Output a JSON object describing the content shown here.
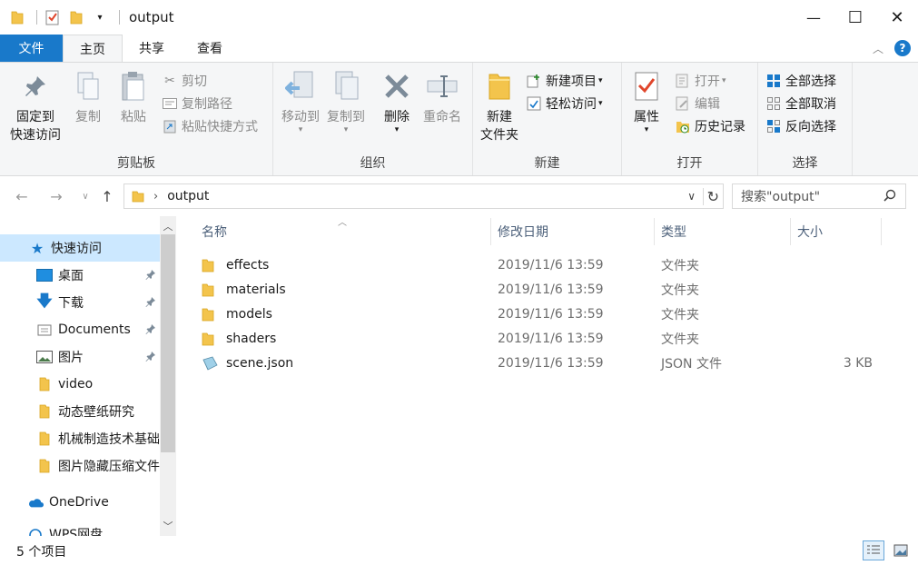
{
  "window": {
    "title": "output",
    "minimize_glyph": "—",
    "maximize_glyph": "☐",
    "close_glyph": "✕"
  },
  "tabs": {
    "file": "文件",
    "home": "主页",
    "share": "共享",
    "view": "查看"
  },
  "ribbon": {
    "clipboard": {
      "label": "剪贴板",
      "pin": "固定到\n快速访问",
      "copy": "复制",
      "paste": "粘贴",
      "cut": "剪切",
      "copy_path": "复制路径",
      "paste_shortcut": "粘贴快捷方式"
    },
    "organize": {
      "label": "组织",
      "move_to": "移动到",
      "copy_to": "复制到",
      "delete": "删除",
      "rename": "重命名"
    },
    "new": {
      "label": "新建",
      "new_folder": "新建\n文件夹",
      "new_item": "新建项目",
      "easy_access": "轻松访问"
    },
    "open": {
      "label": "打开",
      "properties": "属性",
      "open": "打开",
      "edit": "编辑",
      "history": "历史记录"
    },
    "select": {
      "label": "选择",
      "select_all": "全部选择",
      "select_none": "全部取消",
      "invert": "反向选择"
    }
  },
  "address": {
    "path": "output",
    "search_placeholder": "搜索\"output\""
  },
  "nav": {
    "quick_access": "快速访问",
    "items": [
      {
        "label": "桌面",
        "pinned": true
      },
      {
        "label": "下载",
        "pinned": true
      },
      {
        "label": "Documents",
        "pinned": true
      },
      {
        "label": "图片",
        "pinned": true
      },
      {
        "label": "video",
        "pinned": false
      },
      {
        "label": "动态壁纸研究",
        "pinned": false
      },
      {
        "label": "机械制造技术基础",
        "pinned": false
      },
      {
        "label": "图片隐藏压缩文件",
        "pinned": false
      }
    ],
    "onedrive": "OneDrive",
    "wps": "WPS网盘"
  },
  "columns": {
    "name": "名称",
    "date": "修改日期",
    "type": "类型",
    "size": "大小"
  },
  "files": [
    {
      "name": "effects",
      "date": "2019/11/6 13:59",
      "type": "文件夹",
      "size": "",
      "kind": "folder"
    },
    {
      "name": "materials",
      "date": "2019/11/6 13:59",
      "type": "文件夹",
      "size": "",
      "kind": "folder"
    },
    {
      "name": "models",
      "date": "2019/11/6 13:59",
      "type": "文件夹",
      "size": "",
      "kind": "folder"
    },
    {
      "name": "shaders",
      "date": "2019/11/6 13:59",
      "type": "文件夹",
      "size": "",
      "kind": "folder"
    },
    {
      "name": "scene.json",
      "date": "2019/11/6 13:59",
      "type": "JSON 文件",
      "size": "3 KB",
      "kind": "json"
    }
  ],
  "status": {
    "count": "5 个项目"
  },
  "colors": {
    "accent": "#1979ca",
    "selection": "#cce8ff",
    "folder": "#f3c44c"
  }
}
